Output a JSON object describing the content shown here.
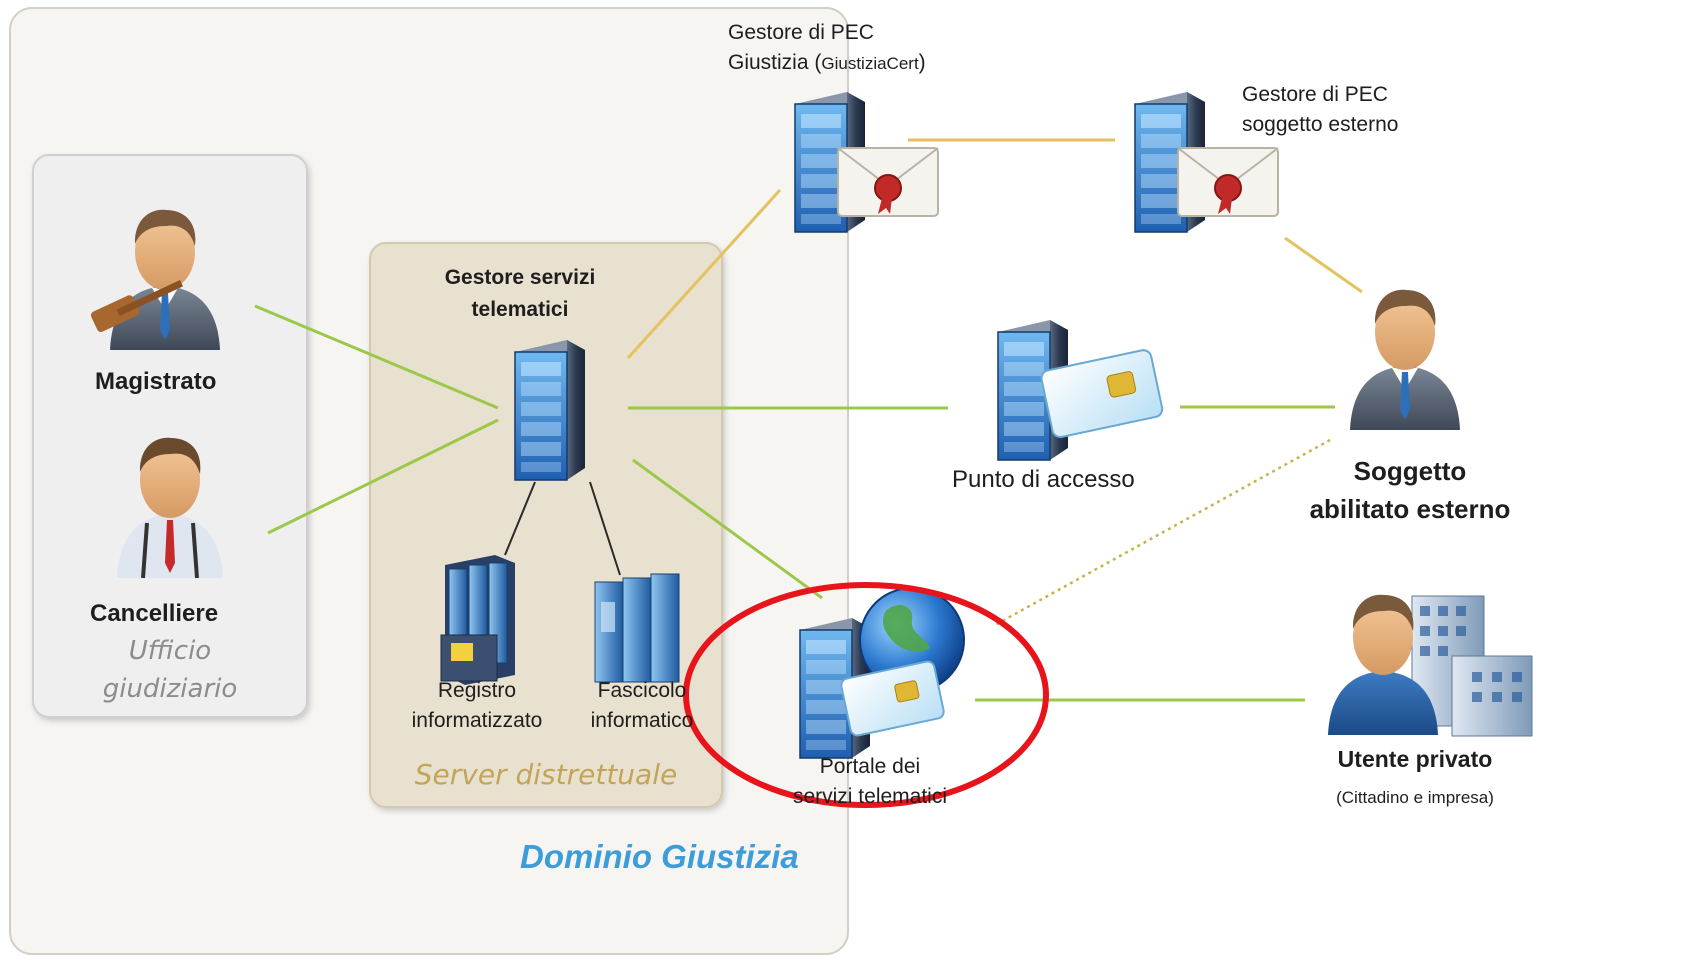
{
  "colors": {
    "green_line": "#9cc84a",
    "gold_line": "#e3c25f",
    "black_line": "#2a2a2a",
    "dotted_line": "#c8b24d",
    "highlight": "#e8141b",
    "domain_text": "#3d9dd9",
    "server_panel": "#e9e1cf",
    "giustizia_area": "#f6f5f2",
    "office_panel": "#efefef"
  },
  "domain": {
    "label": "Dominio Giustizia"
  },
  "ufficio": {
    "label_line1": "Ufficio",
    "label_line2": "giudiziario"
  },
  "server_panel": {
    "title_line1": "Gestore servizi",
    "title_line2": "telematici",
    "footer": "Server distrettuale"
  },
  "actors": {
    "magistrato": "Magistrato",
    "cancelliere": "Cancelliere",
    "soggetto_line1": "Soggetto",
    "soggetto_line2": "abilitato esterno",
    "utente": "Utente privato",
    "utente_sub": "(Cittadino e impresa)"
  },
  "nodes": {
    "registro_line1": "Registro",
    "registro_line2": "informatizzato",
    "fascicolo_line1": "Fascicolo",
    "fascicolo_line2": "informatico",
    "pec_giustizia_line1": "Gestore di PEC",
    "pec_giustizia_line2": "Giustizia",
    "pec_giustizia_cert": "GiustiziaCert",
    "pec_esterno_line1": "Gestore di PEC",
    "pec_esterno_line2": "soggetto esterno",
    "punto_accesso": "Punto di accesso",
    "portale_line1": "Portale dei",
    "portale_line2": "servizi telematici"
  }
}
